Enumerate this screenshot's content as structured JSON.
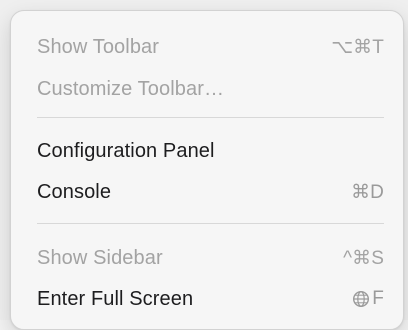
{
  "menu": {
    "items": [
      {
        "label": "Show Toolbar",
        "shortcut": "⌥⌘T",
        "enabled": false
      },
      {
        "label": "Customize Toolbar…",
        "shortcut": "",
        "enabled": false
      },
      {
        "label": "Configuration Panel",
        "shortcut": "",
        "enabled": true
      },
      {
        "label": "Console",
        "shortcut": "⌘D",
        "enabled": true
      },
      {
        "label": "Show Sidebar",
        "shortcut": "^⌘S",
        "enabled": false
      },
      {
        "label": "Enter Full Screen",
        "shortcut_key": "F",
        "shortcut_icon": "globe-icon",
        "enabled": true
      }
    ]
  },
  "colors": {
    "enabled_text": "#1d1d1f",
    "disabled_text": "#a3a3a3",
    "menu_background": "#f6f6f6",
    "separator": "#d8d8d8"
  }
}
